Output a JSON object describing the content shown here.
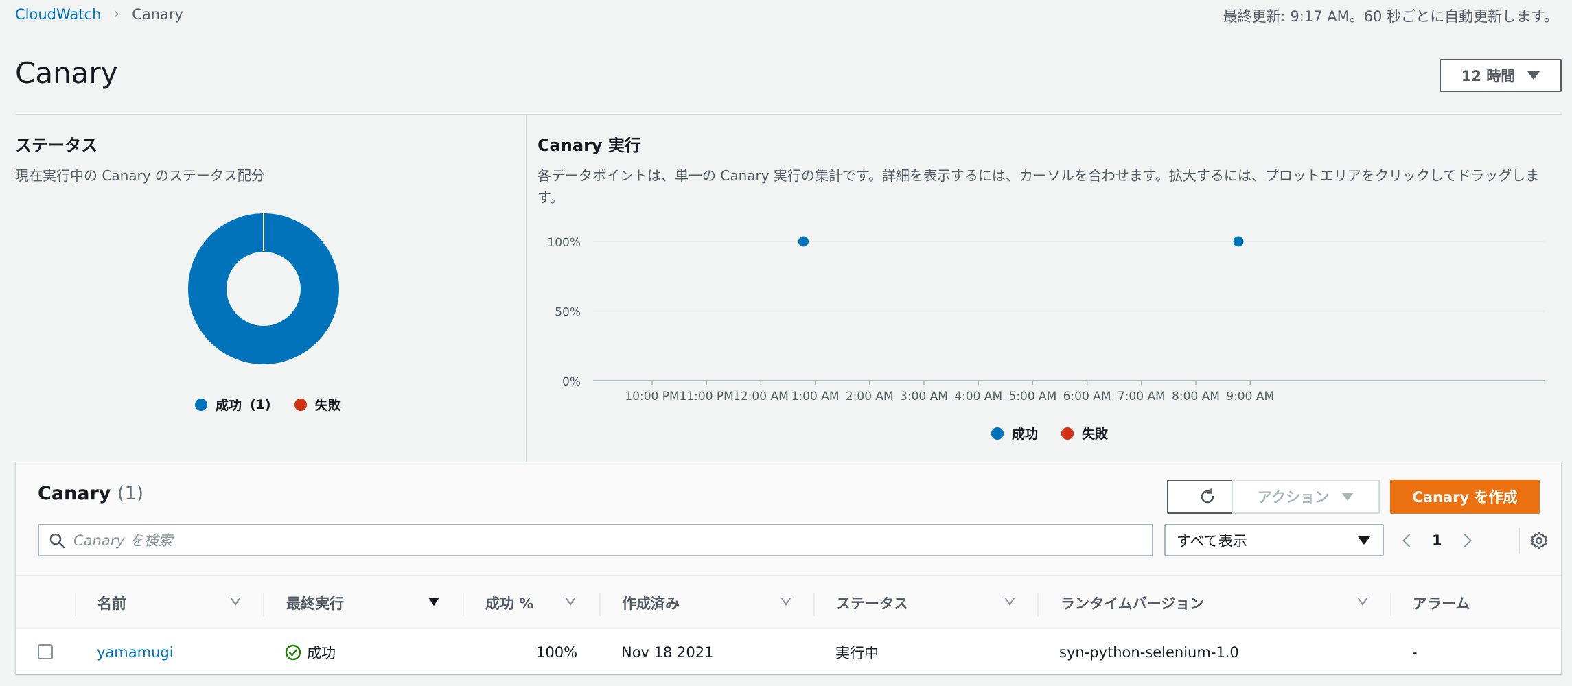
{
  "breadcrumb": {
    "root": "CloudWatch",
    "current": "Canary"
  },
  "last_updated": "最終更新: 9:17 AM。60 秒ごとに自動更新します。",
  "page_title": "Canary",
  "time_range": "12 時間",
  "status_panel": {
    "title": "ステータス",
    "subtitle": "現在実行中の Canary のステータス配分",
    "legend_success": "成功",
    "legend_success_count": "(1)",
    "legend_failure": "失敗"
  },
  "runs_panel": {
    "title": "Canary 実行",
    "subtitle": "各データポイントは、単一の Canary 実行の集計です。詳細を表示するには、カーソルを合わせます。拡大するには、プロットエリアをクリックしてドラッグします。",
    "legend_success": "成功",
    "legend_failure": "失敗"
  },
  "chart_data": [
    {
      "type": "pie",
      "categories": [
        "成功",
        "失敗"
      ],
      "values": [
        1,
        0
      ],
      "colors": [
        "#0073bb",
        "#d13212"
      ]
    },
    {
      "type": "scatter",
      "x_ticks": [
        "10:00 PM",
        "11:00 PM",
        "12:00 AM",
        "1:00 AM",
        "2:00 AM",
        "3:00 AM",
        "4:00 AM",
        "5:00 AM",
        "6:00 AM",
        "7:00 AM",
        "8:00 AM",
        "9:00 AM"
      ],
      "y_ticks": [
        "100%",
        "50%",
        "0%"
      ],
      "ylim": [
        0,
        100
      ],
      "series": [
        {
          "name": "成功",
          "color": "#0073bb",
          "points": [
            {
              "x": "12:47 AM",
              "y": 100
            },
            {
              "x": "8:47 AM",
              "y": 100
            }
          ]
        },
        {
          "name": "失敗",
          "color": "#d13212",
          "points": []
        }
      ],
      "grid": true,
      "legend": "bottom"
    }
  ],
  "table": {
    "title": "Canary",
    "count": "(1)",
    "actions_label": "アクション",
    "create_label": "Canary を作成",
    "search_placeholder": "Canary を検索",
    "filter_value": "すべて表示",
    "page": "1",
    "columns": [
      "名前",
      "最終実行",
      "成功 %",
      "作成済み",
      "ステータス",
      "ランタイムバージョン",
      "アラーム"
    ],
    "rows": [
      {
        "name": "yamamugi",
        "last_run": "成功",
        "success_pct": "100%",
        "created": "Nov 18 2021",
        "status": "実行中",
        "runtime": "syn-python-selenium-1.0",
        "alarm": "-"
      }
    ]
  },
  "colors": {
    "success": "#0073bb",
    "failure": "#d13212",
    "primary_button": "#ec7211",
    "success_icon": "#1d8102"
  }
}
